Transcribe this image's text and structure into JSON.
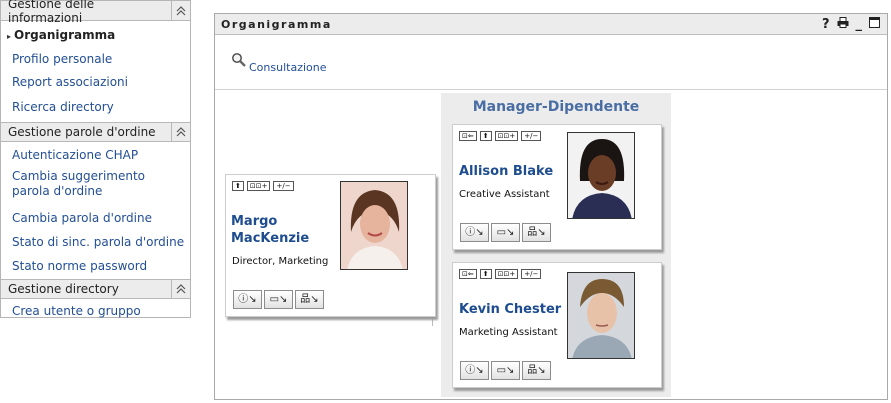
{
  "sidebar": {
    "sections": [
      {
        "title": "Gestione delle informazioni",
        "items": [
          "Organigramma",
          "Profilo personale",
          "Report associazioni",
          "Ricerca directory"
        ]
      },
      {
        "title": "Gestione parole d'ordine",
        "items": [
          "Autenticazione CHAP",
          "Cambia suggerimento parola d'ordine",
          "Cambia parola d'ordine",
          "Stato di sinc. parola d'ordine",
          "Stato norme password"
        ]
      },
      {
        "title": "Gestione directory",
        "items": [
          "Crea utente o gruppo"
        ]
      }
    ]
  },
  "panel": {
    "title": "Organigramma",
    "browse_label": "Consultazione",
    "controls": {
      "help": "?",
      "print": "⎙",
      "minimize": "_",
      "maximize": "□"
    }
  },
  "orgchart": {
    "manager_title": "Manager-Dipendente",
    "chain_buttons": {
      "up": "⬆",
      "tree": "⊡⊡+",
      "toggle": "+/−",
      "back": "⊡⇐"
    },
    "root": {
      "name_line1": "Margo",
      "name_line2": "MacKenzie",
      "role": "Director, Marketing"
    },
    "reports": [
      {
        "name": "Allison Blake",
        "role": "Creative Assistant"
      },
      {
        "name": "Kevin Chester",
        "role": "Marketing Assistant"
      }
    ]
  },
  "colors": {
    "link": "#234f94",
    "title_blue": "#4a6ea4",
    "header_bg": "#ececec"
  }
}
